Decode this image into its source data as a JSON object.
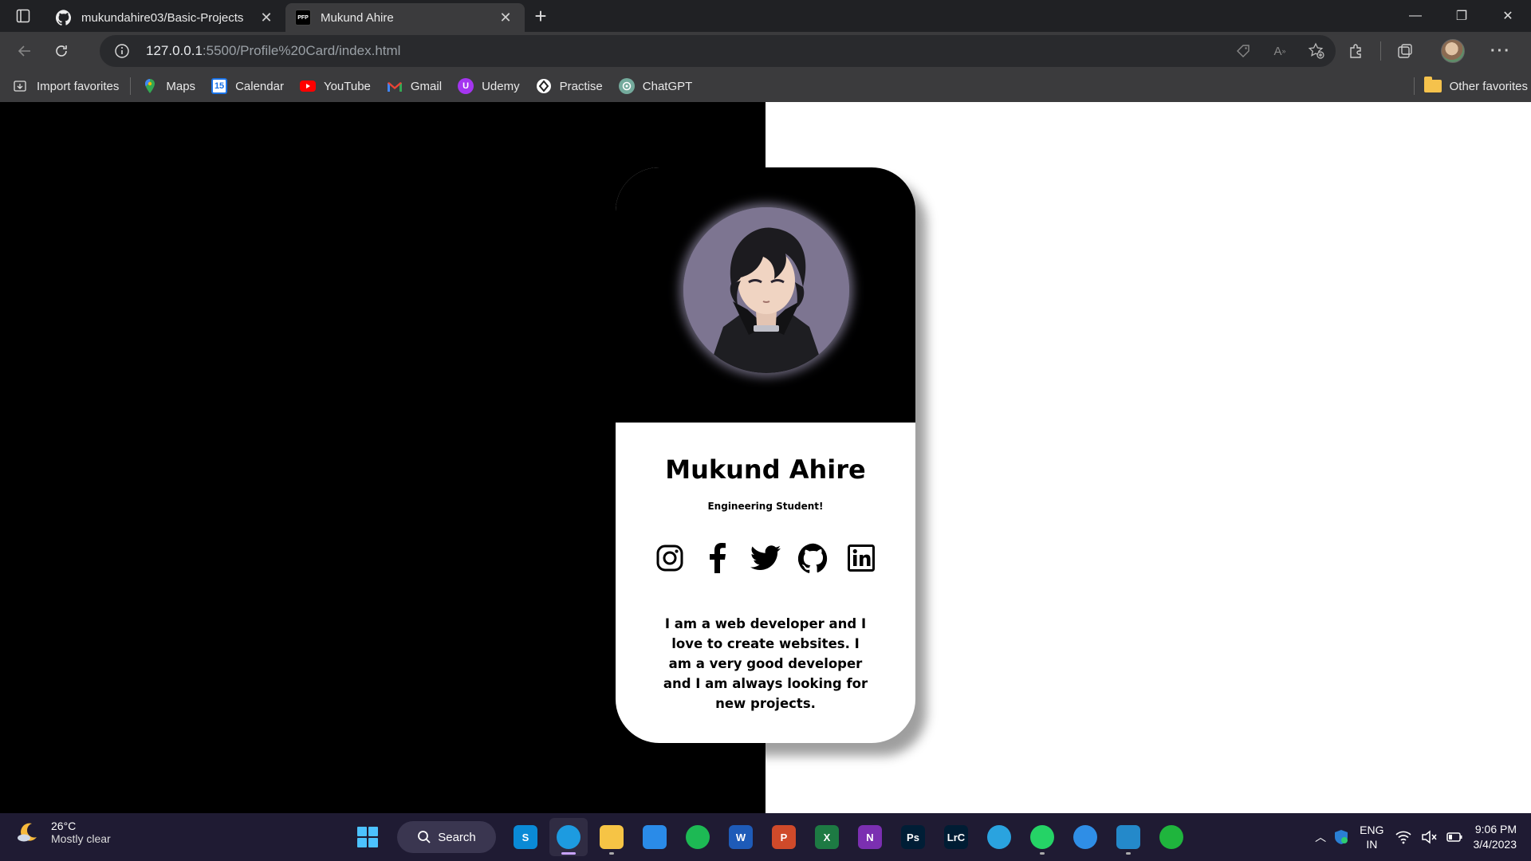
{
  "browser": {
    "tabs": [
      {
        "title": "mukundahire03/Basic-Projects",
        "active": false
      },
      {
        "title": "Mukund Ahire",
        "active": true,
        "favicon_text": "PFP"
      }
    ],
    "address": {
      "host": "127.0.0.1",
      "rest": ":5500/Profile%20Card/index.html"
    },
    "favorites": [
      {
        "label": "Import favorites",
        "icon": "import-icon"
      },
      {
        "label": "Maps",
        "icon": "maps-icon"
      },
      {
        "label": "Calendar",
        "icon": "calendar-icon",
        "icon_text": "15"
      },
      {
        "label": "YouTube",
        "icon": "youtube-icon"
      },
      {
        "label": "Gmail",
        "icon": "gmail-icon"
      },
      {
        "label": "Udemy",
        "icon": "udemy-icon"
      },
      {
        "label": "Practise",
        "icon": "practise-icon"
      },
      {
        "label": "ChatGPT",
        "icon": "chatgpt-icon"
      }
    ],
    "other_favorites": "Other favorites"
  },
  "page": {
    "name": "Mukund Ahire",
    "role": "Engineering Student!",
    "bio": "I am a web developer and I love to create websites. I am a very good developer and I am always looking for new projects.",
    "socials": [
      "instagram-icon",
      "facebook-icon",
      "twitter-icon",
      "github-icon",
      "linkedin-icon"
    ]
  },
  "taskbar": {
    "weather": {
      "temp": "26°C",
      "condition": "Mostly clear"
    },
    "search_label": "Search",
    "apps": [
      {
        "name": "skype-icon",
        "text": "S",
        "color": "#0a8ad6"
      },
      {
        "name": "edge-icon",
        "text": "",
        "color": "#1d9be0"
      },
      {
        "name": "file-explorer-icon",
        "text": "",
        "color": "#f6c445"
      },
      {
        "name": "mail-icon",
        "text": "",
        "color": "#2a8be8"
      },
      {
        "name": "spotify-icon",
        "text": "",
        "color": "#1db954"
      },
      {
        "name": "word-icon",
        "text": "W",
        "color": "#1e5bb8"
      },
      {
        "name": "powerpoint-icon",
        "text": "P",
        "color": "#cf4a2a"
      },
      {
        "name": "excel-icon",
        "text": "X",
        "color": "#1d7a43"
      },
      {
        "name": "onenote-icon",
        "text": "N",
        "color": "#7b2fb1"
      },
      {
        "name": "photoshop-icon",
        "text": "Ps",
        "color": "#001e36"
      },
      {
        "name": "lightroom-classic-icon",
        "text": "LrC",
        "color": "#001d34"
      },
      {
        "name": "telegram-icon",
        "text": "",
        "color": "#2aa3df"
      },
      {
        "name": "whatsapp-icon",
        "text": "",
        "color": "#25d366"
      },
      {
        "name": "app-icon",
        "text": "",
        "color": "#2f8ee6"
      },
      {
        "name": "vscode-icon",
        "text": "",
        "color": "#2489ca"
      },
      {
        "name": "evernote-icon",
        "text": "",
        "color": "#1fb53d"
      }
    ],
    "language": {
      "line1": "ENG",
      "line2": "IN"
    },
    "time": "9:06 PM",
    "date": "3/4/2023"
  }
}
